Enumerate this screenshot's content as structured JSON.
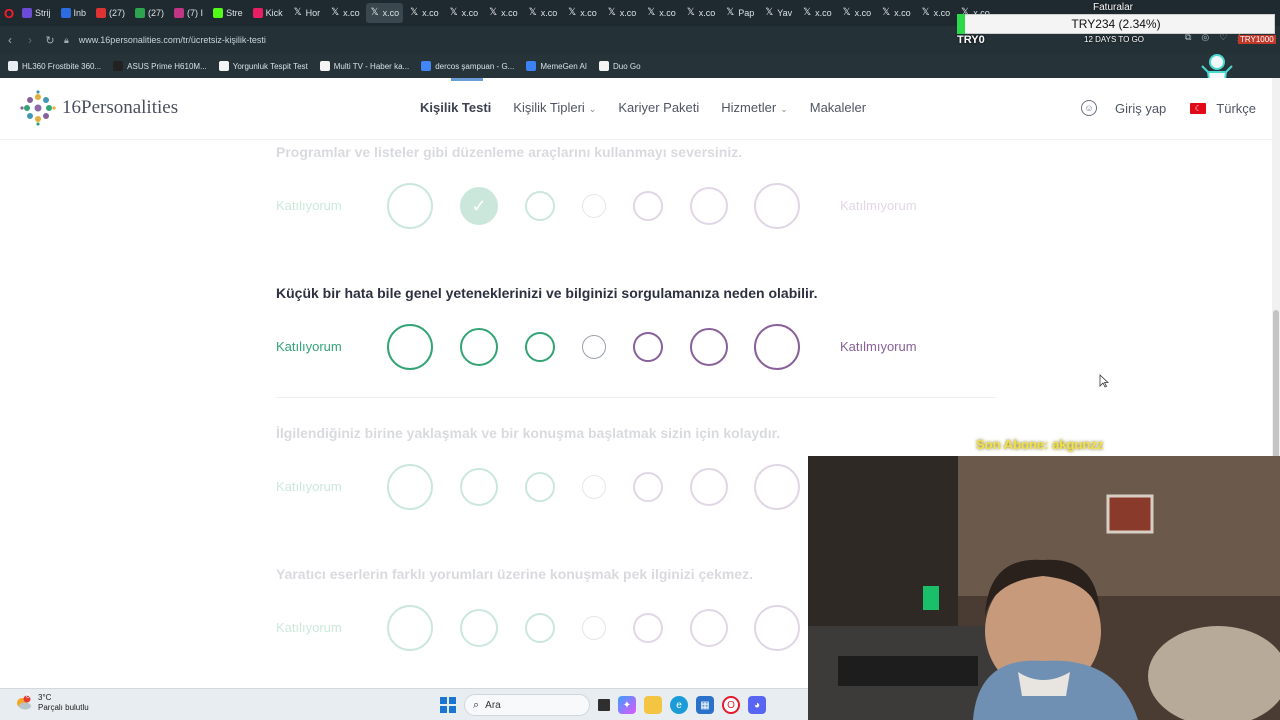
{
  "browser": {
    "tabs": [
      {
        "label": "Strij",
        "color": "#6c4bd8"
      },
      {
        "label": "Inb",
        "color": "#2d6be0"
      },
      {
        "label": "(27)",
        "color": "#d33"
      },
      {
        "label": "(27)",
        "color": "#2da44e"
      },
      {
        "label": "(7) I",
        "color": "#c13584"
      },
      {
        "label": "Stre",
        "color": "#53fc18"
      },
      {
        "label": "Kick",
        "color": "#e91e63"
      },
      {
        "label": "Hor",
        "color": "x"
      },
      {
        "label": "x.co",
        "color": "x"
      },
      {
        "label": "x.co",
        "color": "x"
      },
      {
        "label": "x.co",
        "color": "x"
      },
      {
        "label": "x.co",
        "color": "x"
      },
      {
        "label": "x.co",
        "color": "x"
      },
      {
        "label": "x.co",
        "color": "x"
      },
      {
        "label": "x.co",
        "color": "x"
      },
      {
        "label": "x.co",
        "color": "x"
      },
      {
        "label": "x.co",
        "color": "x"
      },
      {
        "label": "x.co",
        "color": "x"
      },
      {
        "label": "Pap",
        "color": "x"
      },
      {
        "label": "Yav",
        "color": "x"
      },
      {
        "label": "x.co",
        "color": "x"
      },
      {
        "label": "x.co",
        "color": "x"
      },
      {
        "label": "x.co",
        "color": "x"
      },
      {
        "label": "x.co",
        "color": "x"
      },
      {
        "label": "x.co",
        "color": "x"
      }
    ],
    "url": "www.16personalities.com/tr/ücretsiz-kişilik-testi",
    "bookmarks": [
      {
        "label": "HL360 Frostbite 360...",
        "color": "#e8eef1"
      },
      {
        "label": "ASUS Prime H610M...",
        "color": "#222"
      },
      {
        "label": "Yorgunluk Tespit Test",
        "color": "#f4f4f4"
      },
      {
        "label": "Multi TV - Haber ka...",
        "color": "#f4f4f4"
      },
      {
        "label": "dercos şampuan - G...",
        "color": "#4285f4"
      },
      {
        "label": "MemeGen AI",
        "color": "#3b82f6"
      },
      {
        "label": "Duo Go",
        "color": "#f4f4f4"
      }
    ]
  },
  "overlay": {
    "ticker": "TRY234 (2.34%)",
    "ticker_label": "TRY0",
    "faturalar": "Faturalar",
    "countdown": "12 DAYS TO GO",
    "try_right": "TRY1000",
    "sub_alert": "Son Abone: akgunzz"
  },
  "site": {
    "logo": "16Personalities",
    "nav": [
      {
        "label": "Kişilik Testi",
        "caret": false
      },
      {
        "label": "Kişilik Tipleri",
        "caret": true
      },
      {
        "label": "Kariyer Paketi",
        "caret": false
      },
      {
        "label": "Hizmetler",
        "caret": true
      },
      {
        "label": "Makaleler",
        "caret": false
      }
    ],
    "login": "Giriş yap",
    "language": "Türkçe"
  },
  "questions": [
    {
      "text": "Programlar ve listeler gibi düzenleme araçlarını kullanmayı seversiniz.",
      "agree": "Katılıyorum",
      "disagree": "Katılmıyorum",
      "state": "answered",
      "selected_index": 1
    },
    {
      "text": "Küçük bir hata bile genel yeteneklerinizi ve bilginizi sorgulamanıza neden olabilir.",
      "agree": "Katılıyorum",
      "disagree": "Katılmıyorum",
      "state": "active",
      "selected_index": -1
    },
    {
      "text": "İlgilendiğiniz birine yaklaşmak ve bir konuşma başlatmak sizin için kolaydır.",
      "agree": "Katılıyorum",
      "disagree": "Katılmıyorum",
      "state": "upcoming",
      "selected_index": -1
    },
    {
      "text": "Yaratıcı eserlerin farklı yorumları üzerine konuşmak pek ilginizi çekmez.",
      "agree": "Katılıyorum",
      "disagree": "Katılmıyorum",
      "state": "upcoming",
      "selected_index": -1
    }
  ],
  "colors": {
    "agree": "#33a474",
    "disagree": "#88619a",
    "neutral": "#9b9faa"
  },
  "taskbar": {
    "temp": "3°C",
    "weather": "Parçalı bulutlu",
    "weather_badge": "8",
    "search": "Ara"
  }
}
